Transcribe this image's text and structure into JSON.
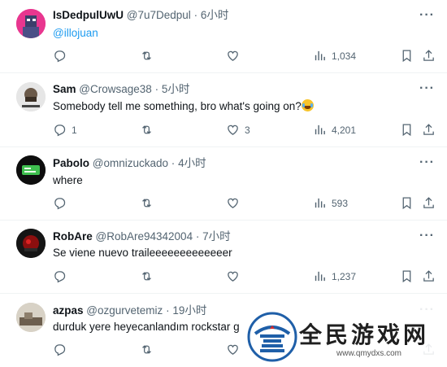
{
  "tweets": [
    {
      "name": "IsDedpulUwU",
      "handle": "@7u7Dedpul",
      "sep": "·",
      "time": "6小时",
      "text": "@illojuan",
      "is_link": true,
      "reply_count": "",
      "like_count": "",
      "views": "1,034"
    },
    {
      "name": "Sam",
      "handle": "@Crowsage38",
      "sep": "·",
      "time": "5小时",
      "text": "Somebody tell me something, bro what's going on?",
      "emoji": "face-with-tears-of-joy",
      "reply_count": "1",
      "like_count": "3",
      "views": "4,201"
    },
    {
      "name": "Pabolo",
      "handle": "@omnizuckado",
      "sep": "·",
      "time": "4小时",
      "text": "where",
      "reply_count": "",
      "like_count": "",
      "views": "593"
    },
    {
      "name": "RobAre",
      "handle": "@RobAre94342004",
      "sep": "·",
      "time": "7小时",
      "text": "Se viene nuevo traileeeeeeeeeeeeer",
      "reply_count": "",
      "like_count": "",
      "views": "1,237"
    },
    {
      "name": "azpas",
      "handle": "@ozgurvetemiz",
      "sep": "·",
      "time": "19小时",
      "text": "durduk yere heyecanlandım rockstar g",
      "reply_count": "",
      "like_count": "",
      "views": ""
    }
  ],
  "more_label": "···",
  "watermark": {
    "title": "全民游戏网",
    "url": "www.qmydxs.com"
  },
  "colors": {
    "text": "#0f1419",
    "muted": "#536471",
    "link": "#1d9bf0",
    "divider": "#eff3f4"
  }
}
